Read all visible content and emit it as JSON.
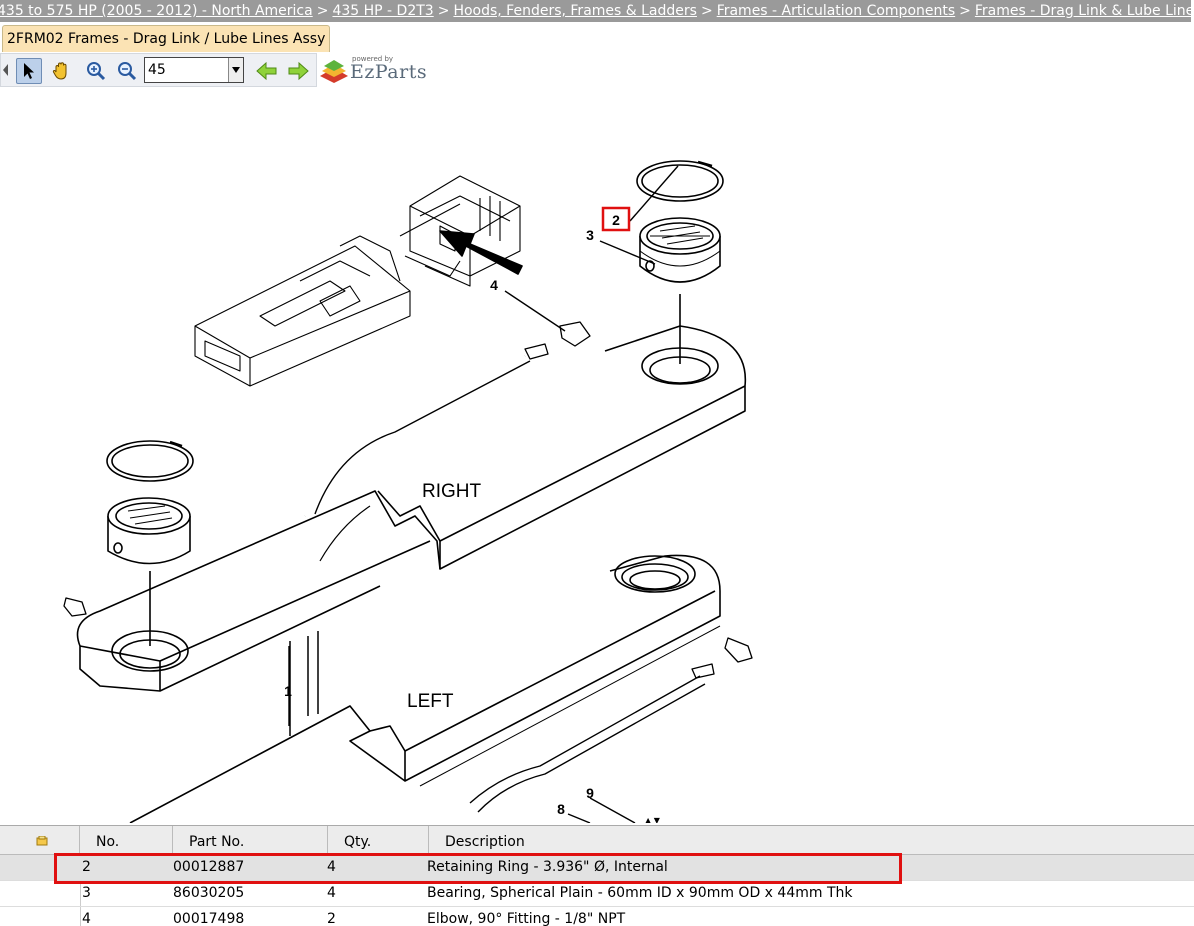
{
  "breadcrumb": [
    "435 to 575 HP (2005 - 2012) - North America",
    "435 HP - D2T3",
    "Hoods, Fenders, Frames & Ladders",
    "Frames - Articulation Components",
    "Frames - Drag Link & Lube Lines"
  ],
  "breadcrumb_separator": ">",
  "tab": {
    "label": "2FRM02 Frames - Drag Link / Lube Lines Assy"
  },
  "toolbar": {
    "zoom_value": "45",
    "logo_powered": "powered by",
    "logo_brand": "EzParts",
    "icons": [
      "select-arrow-icon",
      "pan-hand-icon",
      "zoom-in-icon",
      "zoom-out-icon",
      "back-arrow-icon",
      "forward-arrow-icon"
    ]
  },
  "diagram": {
    "callouts": [
      "1",
      "2",
      "3",
      "4",
      "8",
      "9"
    ],
    "highlighted_callout": "2",
    "labels": {
      "right": "RIGHT",
      "left": "LEFT"
    },
    "highlight_color": "#e01010"
  },
  "parts_table": {
    "columns": [
      "No.",
      "Part No.",
      "Qty.",
      "Description"
    ],
    "rows": [
      {
        "no": "2",
        "part_no": "00012887",
        "qty": "4",
        "description": "Retaining Ring - 3.936\" Ø, Internal",
        "selected": true
      },
      {
        "no": "3",
        "part_no": "86030205",
        "qty": "4",
        "description": "Bearing, Spherical Plain - 60mm ID x 90mm OD x 44mm Thk",
        "selected": false
      },
      {
        "no": "4",
        "part_no": "00017498",
        "qty": "2",
        "description": "Elbow, 90° Fitting - 1/8\" NPT",
        "selected": false
      }
    ]
  }
}
